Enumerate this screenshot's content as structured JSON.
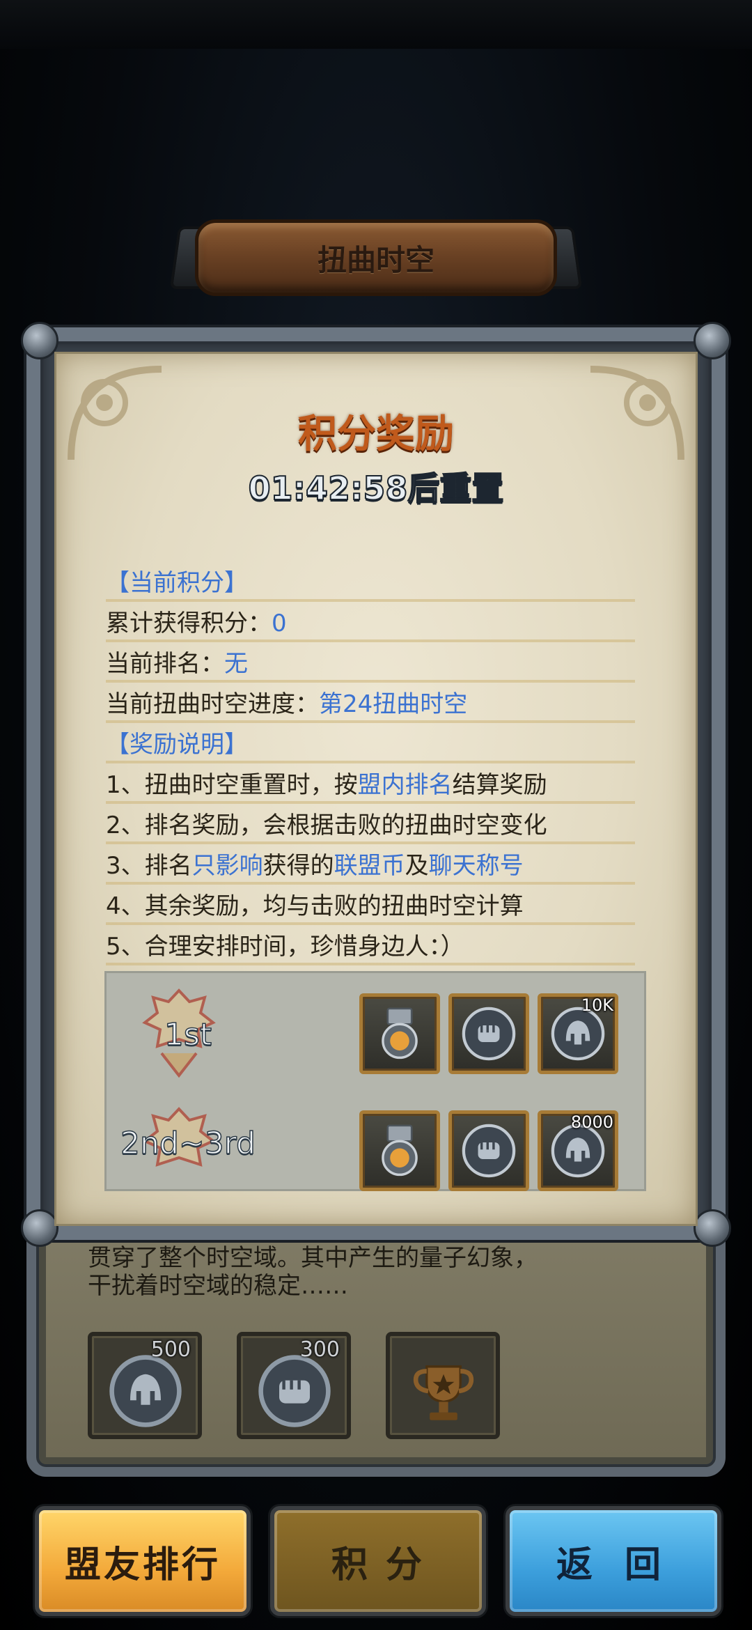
{
  "header": {
    "title": "扭曲时空"
  },
  "panel": {
    "title": "积分奖励",
    "reset_text": "01:42:58后重置"
  },
  "info": {
    "current_section": "【当前积分】",
    "accum_label": "累计获得积分：",
    "accum_value": "0",
    "rank_label": "当前排名：",
    "rank_value": "无",
    "progress_label": "当前扭曲时空进度：",
    "progress_value": "第24扭曲时空",
    "reward_section": "【奖励说明】",
    "rule1_a": "1、扭曲时空重置时，按",
    "rule1_hl": "盟内排名",
    "rule1_b": "结算奖励",
    "rule2": "2、排名奖励，会根据击败的扭曲时空变化",
    "rule3_a": "3、排名",
    "rule3_hl1": "只影响",
    "rule3_b": "获得的",
    "rule3_hl2": "联盟币",
    "rule3_c": "及",
    "rule3_hl3": "聊天称号",
    "rule4": "4、其余奖励，均与击败的扭曲时空计算",
    "rule5": "5、合理安排时间，珍惜身边人：）"
  },
  "ranks": [
    {
      "label": "1st",
      "rewards": [
        {
          "icon": "medal-icon",
          "amount": ""
        },
        {
          "icon": "fist-coin-icon",
          "amount": ""
        },
        {
          "icon": "helmet-coin-icon",
          "amount": "10K"
        }
      ]
    },
    {
      "label": "2nd~3rd",
      "rewards": [
        {
          "icon": "medal-icon",
          "amount": ""
        },
        {
          "icon": "fist-coin-icon",
          "amount": ""
        },
        {
          "icon": "helmet-coin-icon",
          "amount": "8000"
        }
      ]
    }
  ],
  "back_panel": {
    "line1": "贯穿了整个时空域。其中产生的量子幻象，",
    "line2": "干扰着时空域的稳定……",
    "rewards": [
      {
        "icon": "helmet-coin-icon",
        "amount": "500"
      },
      {
        "icon": "fist-coin-icon",
        "amount": "300"
      },
      {
        "icon": "trophy-icon",
        "amount": ""
      }
    ]
  },
  "buttons": {
    "ally_rank": "盟友排行",
    "points": "积 分",
    "back": "返 回"
  },
  "colors": {
    "highlight": "#3b72d1",
    "title_orange": "#c05a1c",
    "gold_button": "#f3a93a",
    "blue_button": "#3c9fdc"
  }
}
